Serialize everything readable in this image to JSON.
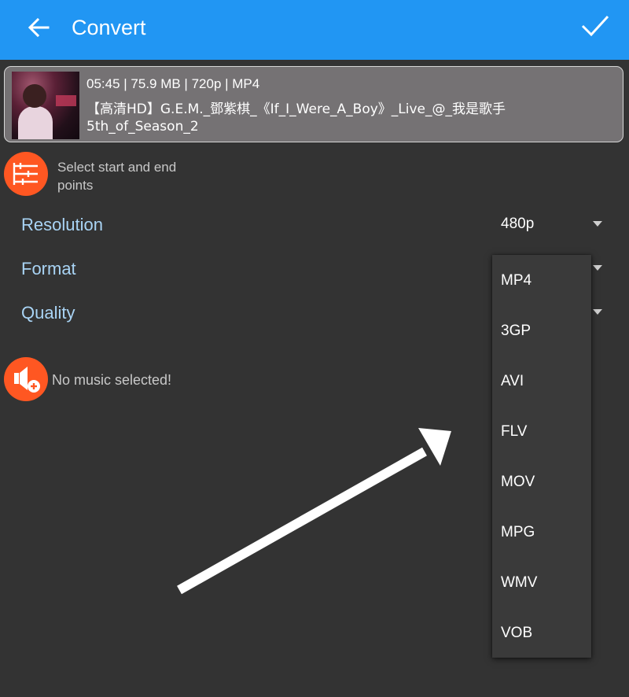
{
  "appbar": {
    "title": "Convert",
    "back_icon": "arrow-left-icon",
    "confirm_icon": "checkmark-icon",
    "background": "#2196f3"
  },
  "video": {
    "meta": "05:45 | 75.9 MB | 720p | MP4",
    "title": "【高清HD】G.E.M._鄧紫棋_《If_I_Were_A_Boy》_Live_@_我是歌手5th_of_Season_2"
  },
  "trim": {
    "icon": "sliders-icon",
    "label": "Select start and end points"
  },
  "settings": {
    "resolution": {
      "label": "Resolution",
      "value": "480p"
    },
    "format": {
      "label": "Format",
      "value": ""
    },
    "quality": {
      "label": "Quality",
      "value": ""
    }
  },
  "music": {
    "icon": "add-music-icon",
    "label": "No music selected!"
  },
  "format_dropdown": {
    "options": [
      "MP4",
      "3GP",
      "AVI",
      "FLV",
      "MOV",
      "MPG",
      "WMV",
      "VOB"
    ]
  },
  "colors": {
    "accent_orange": "#ff5722",
    "label_blue": "#a9d4f5",
    "background": "#333333"
  }
}
